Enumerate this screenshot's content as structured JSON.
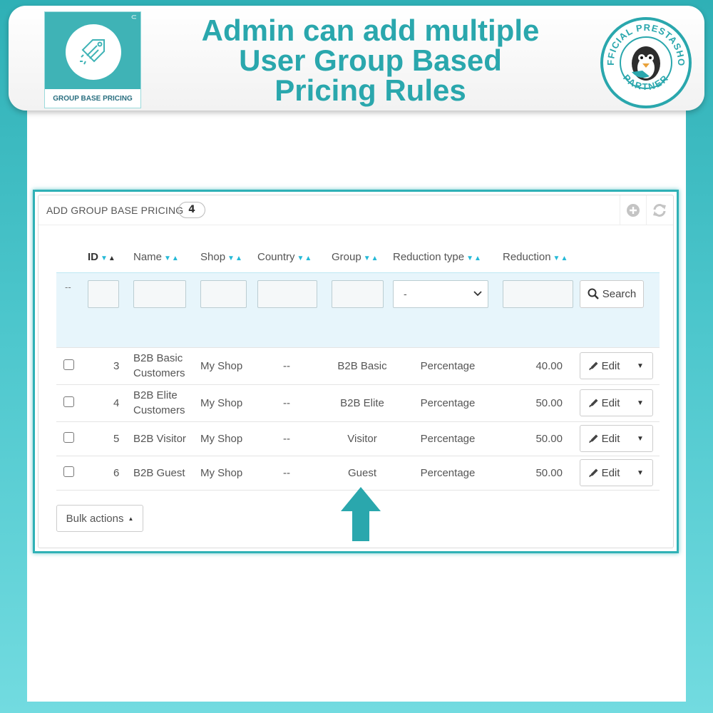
{
  "banner": {
    "headline_lines": [
      "Admin can add multiple",
      "User Group Based",
      "Pricing Rules"
    ],
    "logo_caption": "GROUP BASE PRICING",
    "partner_badge_top": "OFFICIAL PRESTASHOP",
    "partner_badge_bottom": "PARTNER",
    "colors": {
      "accent": "#2aa7ad",
      "panel_border": "#2fb1b6"
    }
  },
  "panel": {
    "title": "ADD GROUP BASE PRICING",
    "count": "4",
    "tools": [
      "add-icon",
      "refresh-icon"
    ]
  },
  "table": {
    "columns": [
      {
        "key": "id",
        "label": "ID"
      },
      {
        "key": "name",
        "label": "Name"
      },
      {
        "key": "shop",
        "label": "Shop"
      },
      {
        "key": "country",
        "label": "Country"
      },
      {
        "key": "group",
        "label": "Group"
      },
      {
        "key": "reduction_type",
        "label": "Reduction type"
      },
      {
        "key": "reduction",
        "label": "Reduction"
      }
    ],
    "filter": {
      "row_marker": "--",
      "reduction_type_selected": "-",
      "search_label": "Search"
    },
    "rows": [
      {
        "id": "3",
        "name": "B2B Basic Customers",
        "shop": "My Shop",
        "country": "--",
        "group": "B2B Basic",
        "reduction_type": "Percentage",
        "reduction": "40.00"
      },
      {
        "id": "4",
        "name": "B2B Elite Customers",
        "shop": "My Shop",
        "country": "--",
        "group": "B2B Elite",
        "reduction_type": "Percentage",
        "reduction": "50.00"
      },
      {
        "id": "5",
        "name": "B2B Visitor",
        "shop": "My Shop",
        "country": "--",
        "group": "Visitor",
        "reduction_type": "Percentage",
        "reduction": "50.00"
      },
      {
        "id": "6",
        "name": "B2B Guest",
        "shop": "My Shop",
        "country": "--",
        "group": "Guest",
        "reduction_type": "Percentage",
        "reduction": "50.00"
      }
    ],
    "edit_label": "Edit"
  },
  "footer": {
    "bulk_actions_label": "Bulk actions"
  }
}
